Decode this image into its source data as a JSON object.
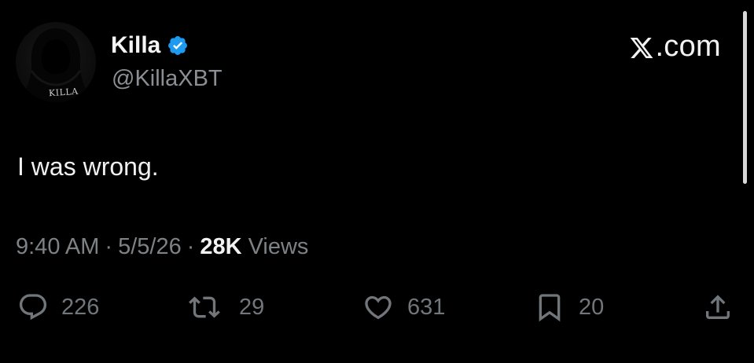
{
  "author": {
    "display_name": "Killa",
    "handle": "@KillaXBT",
    "avatar_text": "KILLA",
    "verified": true
  },
  "site": {
    "label": ".com",
    "logo_icon": "x-logo-icon"
  },
  "tweet": {
    "text": "I was wrong."
  },
  "meta": {
    "time": "9:40 AM",
    "separator": "·",
    "date": "5/5/26",
    "views_count": "28K",
    "views_label": "Views"
  },
  "actions": {
    "replies": "226",
    "reposts": "29",
    "likes": "631",
    "bookmarks": "20"
  },
  "colors": {
    "background": "#000000",
    "verified_badge": "#1d9bf0",
    "muted_text": "#71767b",
    "primary_text": "#e7e9ea"
  }
}
